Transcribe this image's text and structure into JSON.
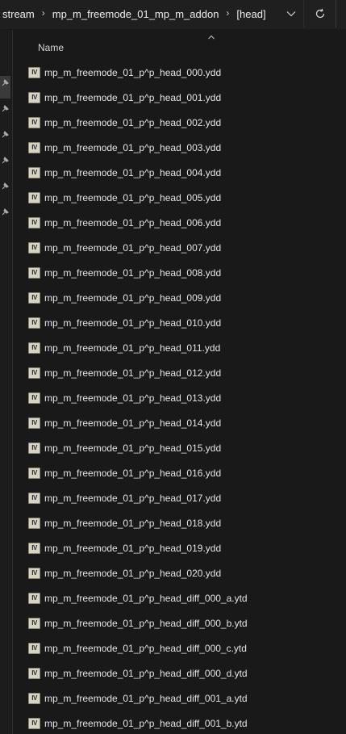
{
  "address_bar": {
    "breadcrumbs": [
      "stream",
      "mp_m_freemode_01_mp_m_addon",
      "[head]"
    ],
    "separator": "›",
    "dropdown_icon": "chevron-down-icon",
    "refresh_icon": "refresh-icon"
  },
  "nav_pane": {
    "pin_icon": "pin-icon",
    "pin_count": 6
  },
  "columns": {
    "name": "Name",
    "sort_icon": "sort-ascending-icon"
  },
  "file_icon": {
    "glyph": "IV",
    "name": "ydd-file-icon"
  },
  "files": [
    "mp_m_freemode_01_p^p_head_000.ydd",
    "mp_m_freemode_01_p^p_head_001.ydd",
    "mp_m_freemode_01_p^p_head_002.ydd",
    "mp_m_freemode_01_p^p_head_003.ydd",
    "mp_m_freemode_01_p^p_head_004.ydd",
    "mp_m_freemode_01_p^p_head_005.ydd",
    "mp_m_freemode_01_p^p_head_006.ydd",
    "mp_m_freemode_01_p^p_head_007.ydd",
    "mp_m_freemode_01_p^p_head_008.ydd",
    "mp_m_freemode_01_p^p_head_009.ydd",
    "mp_m_freemode_01_p^p_head_010.ydd",
    "mp_m_freemode_01_p^p_head_011.ydd",
    "mp_m_freemode_01_p^p_head_012.ydd",
    "mp_m_freemode_01_p^p_head_013.ydd",
    "mp_m_freemode_01_p^p_head_014.ydd",
    "mp_m_freemode_01_p^p_head_015.ydd",
    "mp_m_freemode_01_p^p_head_016.ydd",
    "mp_m_freemode_01_p^p_head_017.ydd",
    "mp_m_freemode_01_p^p_head_018.ydd",
    "mp_m_freemode_01_p^p_head_019.ydd",
    "mp_m_freemode_01_p^p_head_020.ydd",
    "mp_m_freemode_01_p^p_head_diff_000_a.ytd",
    "mp_m_freemode_01_p^p_head_diff_000_b.ytd",
    "mp_m_freemode_01_p^p_head_diff_000_c.ytd",
    "mp_m_freemode_01_p^p_head_diff_000_d.ytd",
    "mp_m_freemode_01_p^p_head_diff_001_a.ytd",
    "mp_m_freemode_01_p^p_head_diff_001_b.ytd"
  ],
  "colors": {
    "background": "#191919",
    "text": "#e4e4e4",
    "icon_fill": "#d8d4c4"
  }
}
